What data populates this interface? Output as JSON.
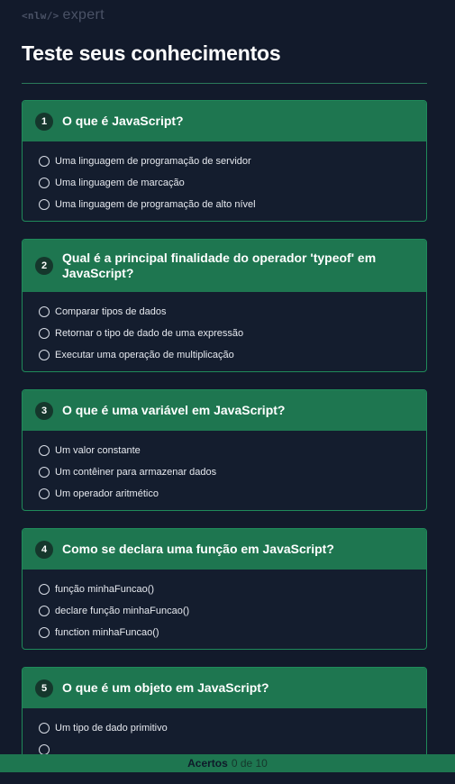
{
  "logo": {
    "brand": "<nlw/>",
    "text": "expert"
  },
  "page": {
    "title": "Teste seus conhecimentos"
  },
  "questions": [
    {
      "number": "1",
      "text": "O que é JavaScript?",
      "options": [
        "Uma linguagem de programação de servidor",
        "Uma linguagem de marcação",
        "Uma linguagem de programação de alto nível"
      ]
    },
    {
      "number": "2",
      "text": "Qual é a principal finalidade do operador 'typeof' em JavaScript?",
      "options": [
        "Comparar tipos de dados",
        "Retornar o tipo de dado de uma expressão",
        "Executar uma operação de multiplicação"
      ]
    },
    {
      "number": "3",
      "text": "O que é uma variável em JavaScript?",
      "options": [
        "Um valor constante",
        "Um contêiner para armazenar dados",
        "Um operador aritmético"
      ]
    },
    {
      "number": "4",
      "text": "Como se declara uma função em JavaScript?",
      "options": [
        "função minhaFuncao()",
        "declare função minhaFuncao()",
        "function minhaFuncao()"
      ]
    },
    {
      "number": "5",
      "text": "O que é um objeto em JavaScript?",
      "options": [
        "Um tipo de dado primitivo"
      ]
    }
  ],
  "footer": {
    "label": "Acertos",
    "count": "0 de 10"
  }
}
